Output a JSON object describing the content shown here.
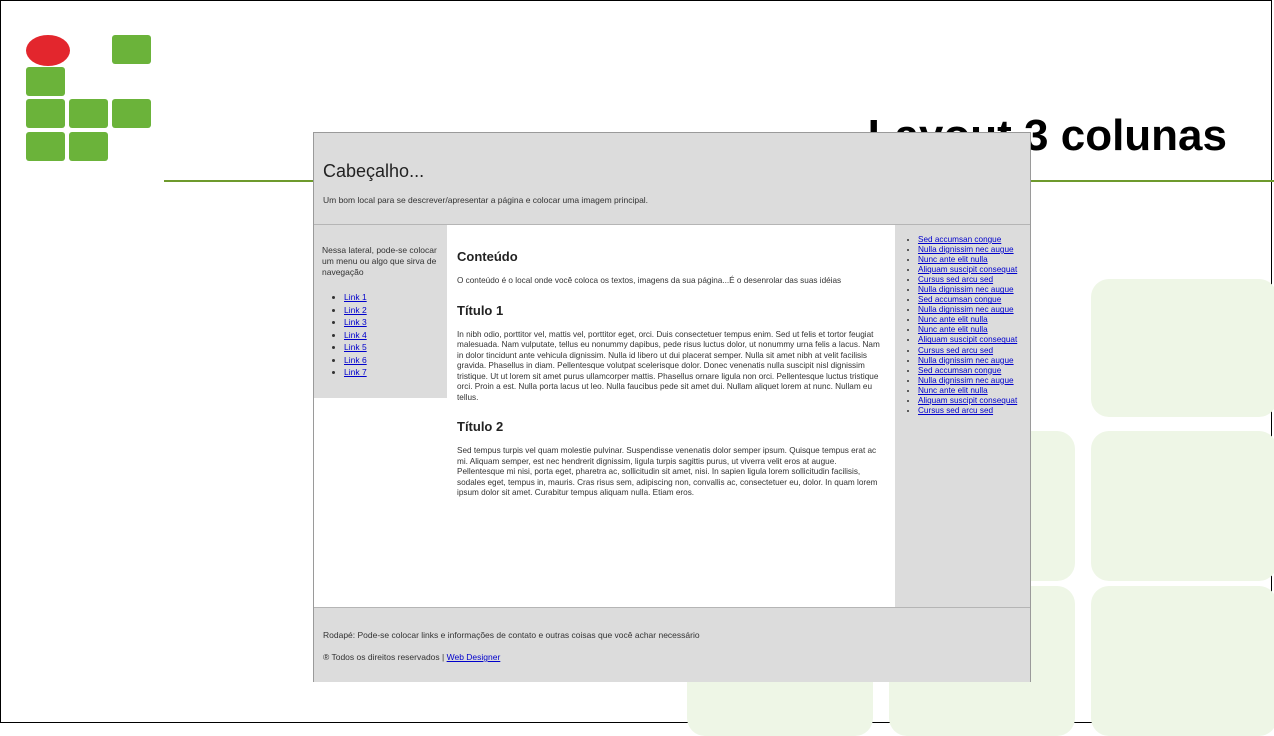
{
  "slide": {
    "title": "Layout 3 colunas",
    "logo_colors": {
      "red": "#e3262d",
      "green": "#6bb33a"
    }
  },
  "screenshot": {
    "header": {
      "title": "Cabeçalho...",
      "subtitle": "Um bom local para se descrever/apresentar a página e colocar uma imagem principal."
    },
    "left": {
      "intro": "Nessa lateral, pode-se colocar um menu ou algo que sirva de navegação",
      "links": [
        "Link 1",
        "Link 2",
        "Link 3",
        "Link 4",
        "Link 5",
        "Link 6",
        "Link 7"
      ]
    },
    "main": {
      "heading": "Conteúdo",
      "intro": "O conteúdo é o local onde você coloca os textos, imagens da sua página...É o desenrolar das suas idéias",
      "section1": {
        "title": "Título 1",
        "body": "In nibh odio, porttitor vel, mattis vel, porttitor eget, orci. Duis consectetuer tempus enim. Sed ut felis et tortor feugiat malesuada. Nam vulputate, tellus eu nonummy dapibus, pede risus luctus dolor, ut nonummy urna felis a lacus. Nam in dolor tincidunt ante vehicula dignissim. Nulla id libero ut dui placerat semper. Nulla sit amet nibh at velit facilisis gravida. Phasellus in diam. Pellentesque volutpat scelerisque dolor. Donec venenatis nulla suscipit nisl dignissim tristique. Ut ut lorem sit amet purus ullamcorper mattis. Phasellus ornare ligula non orci. Pellentesque luctus tristique orci. Proin a est. Nulla porta lacus ut leo. Nulla faucibus pede sit amet dui. Nullam aliquet lorem at nunc. Nullam eu tellus."
      },
      "section2": {
        "title": "Título 2",
        "body": "Sed tempus turpis vel quam molestie pulvinar. Suspendisse venenatis dolor semper ipsum. Quisque tempus erat ac mi. Aliquam semper, est nec hendrerit dignissim, ligula turpis sagittis purus, ut viverra velit eros at augue. Pellentesque mi nisi, porta eget, pharetra ac, sollicitudin sit amet, nisi. In sapien ligula lorem sollicitudin facilisis, sodales eget, tempus in, mauris. Cras risus sem, adipiscing non, convallis ac, consectetuer eu, dolor. In quam lorem ipsum dolor sit amet. Curabitur tempus aliquam nulla. Etiam eros."
      }
    },
    "right": {
      "links": [
        "Sed accumsan congue",
        "Nulla dignissim nec augue",
        "Nunc ante elit nulla",
        "Aliquam suscipit consequat",
        "Cursus sed arcu sed",
        "Nulla dignissim nec augue",
        "Sed accumsan congue",
        "Nulla dignissim nec augue",
        "Nunc ante elit nulla",
        "Nunc ante elit nulla",
        "Aliquam suscipit consequat",
        "Cursus sed arcu sed",
        "Nulla dignissim nec augue",
        "Sed accumsan congue",
        "Nulla dignissim nec augue",
        "Nunc ante elit nulla",
        "Aliquam suscipit consequat",
        "Cursus sed arcu sed"
      ]
    },
    "footer": {
      "text": "Rodapé: Pode-se colocar links e informações de contato e outras coisas que você achar necessário",
      "copyright": "® Todos os direitos reservados | ",
      "designer_link": "Web Designer"
    }
  }
}
